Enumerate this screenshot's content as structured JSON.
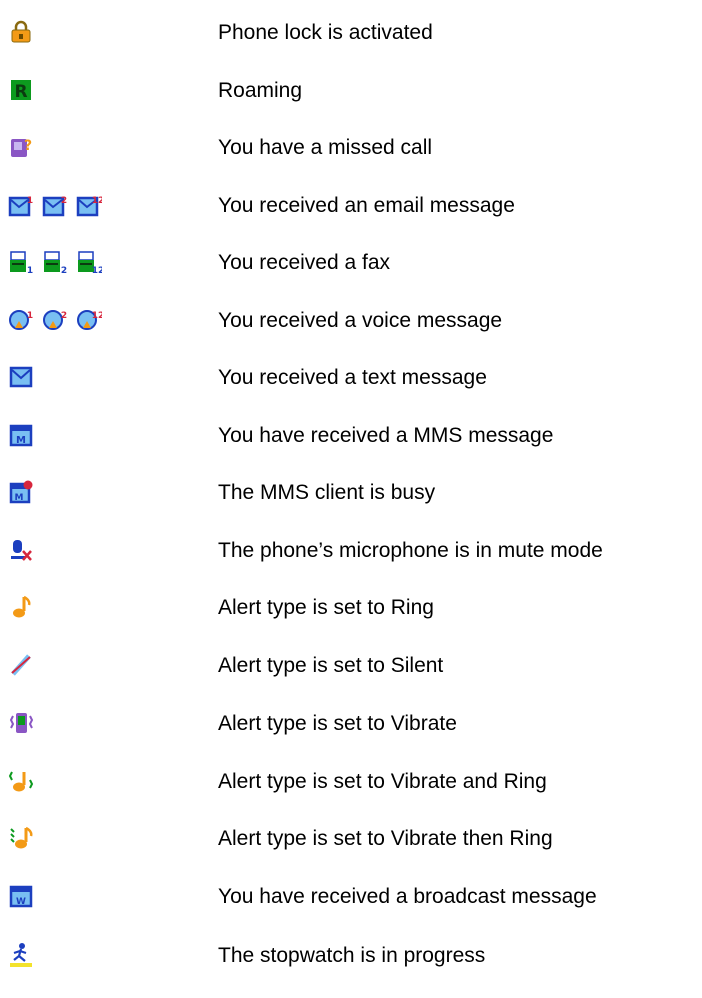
{
  "legend": [
    {
      "label": "Phone lock is activated",
      "icons": [
        "padlock-icon"
      ]
    },
    {
      "label": "Roaming",
      "icons": [
        "roaming-r-icon"
      ]
    },
    {
      "label": "You have a missed call",
      "icons": [
        "missed-call-icon"
      ]
    },
    {
      "label": "You received an email message",
      "icons": [
        "email-1-icon",
        "email-2-icon",
        "email-12-icon"
      ]
    },
    {
      "label": "You received a fax",
      "icons": [
        "fax-1-icon",
        "fax-2-icon",
        "fax-12-icon"
      ]
    },
    {
      "label": "You received a voice message",
      "icons": [
        "voice-message-1-icon",
        "voice-message-2-icon",
        "voice-message-12-icon"
      ]
    },
    {
      "label": "You received a text message",
      "icons": [
        "envelope-icon"
      ]
    },
    {
      "label": "You have received a MMS message",
      "icons": [
        "mms-icon"
      ]
    },
    {
      "label": "The MMS client is busy",
      "icons": [
        "mms-busy-icon"
      ]
    },
    {
      "label": "The phone’s microphone is in mute mode",
      "icons": [
        "mute-microphone-icon"
      ]
    },
    {
      "label": "Alert type is set to Ring",
      "icons": [
        "ring-note-icon"
      ]
    },
    {
      "label": "Alert type is set to Silent",
      "icons": [
        "silent-icon"
      ]
    },
    {
      "label": "Alert type is set to Vibrate",
      "icons": [
        "vibrate-icon"
      ]
    },
    {
      "label": "Alert type is set to Vibrate and Ring",
      "icons": [
        "vibrate-and-ring-icon"
      ]
    },
    {
      "label": "Alert type is set to Vibrate then Ring",
      "icons": [
        "vibrate-then-ring-icon"
      ]
    },
    {
      "label": "You have received a broadcast message",
      "icons": [
        "broadcast-message-icon"
      ]
    },
    {
      "label": "The stopwatch is in progress",
      "icons": [
        "stopwatch-runner-icon"
      ]
    }
  ],
  "colors": {
    "blue_frame": "#1c3fbf",
    "light_blue": "#79bff2",
    "green": "#0c9a1e",
    "orange": "#f39a16",
    "purple": "#8a56c4",
    "red": "#d7263d",
    "yellow": "#f3e22b"
  }
}
